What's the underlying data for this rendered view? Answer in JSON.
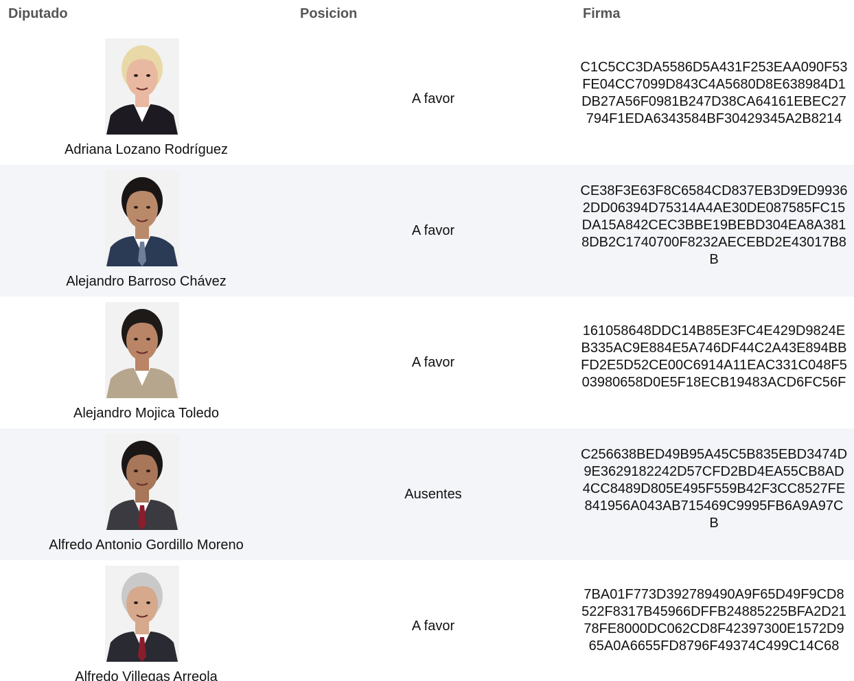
{
  "headers": {
    "diputado": "Diputado",
    "posicion": "Posicion",
    "firma": "Firma"
  },
  "rows": [
    {
      "name": "Adriana Lozano Rodríguez",
      "position": "A favor",
      "firma": "C1C5CC3DA5586D5A431F253EAA090F53FE04CC7099D843C4A5680D8E638984D1DB27A56F0981B247D38CA64161EBEC27794F1EDA6343584BF30429345A2B8214",
      "photo": {
        "bg": "#f2f2f2",
        "skin": "#e8b9a0",
        "hair": "#e9d9a6",
        "suit": "#1d1a22",
        "tie": "none"
      }
    },
    {
      "name": "Alejandro Barroso Chávez",
      "position": "A favor",
      "firma": "CE38F3E63F8C6584CD837EB3D9ED99362DD06394D75314A4AE30DE087585FC15DA15A842CEC3BBE19BEBD304EA8A3818DB2C1740700F8232AECEBD2E43017B8B",
      "photo": {
        "bg": "#f2f2f2",
        "skin": "#b98a6a",
        "hair": "#1a1616",
        "suit": "#2b3a55",
        "tie": "#6e7f98"
      }
    },
    {
      "name": "Alejandro Mojica Toledo",
      "position": "A favor",
      "firma": "161058648DDC14B85E3FC4E429D9824EB335AC9E884E5A746DF44C2A43E894BBFD2E5D52CE00C6914A11EAC331C048F503980658D0E5F18ECB19483ACD6FC56F",
      "photo": {
        "bg": "#f2f2f2",
        "skin": "#b98566",
        "hair": "#1e1a18",
        "suit": "#b7a68e",
        "tie": "none"
      }
    },
    {
      "name": "Alfredo Antonio Gordillo Moreno",
      "position": "Ausentes",
      "firma": "C256638BED49B95A45C5B835EBD3474D9E3629182242D57CFD2BD4EA55CB8AD4CC8489D805E495F559B42F3CC8527FE841956A043AB715469C9995FB6A9A97CB",
      "photo": {
        "bg": "#f2f2f2",
        "skin": "#a87658",
        "hair": "#1a1716",
        "suit": "#3a3a40",
        "tie": "#8a1d2c"
      }
    },
    {
      "name": "Alfredo Villegas Arreola",
      "position": "A favor",
      "firma": "7BA01F773D392789490A9F65D49F9CD8522F8317B45966DFFB24885225BFA2D2178FE8000DC062CD8F42397300E1572D965A0A6655FD8796F49374C499C14C68",
      "photo": {
        "bg": "#f2f2f2",
        "skin": "#d6a98c",
        "hair": "#c9c9c9",
        "suit": "#2a2a32",
        "tie": "#8a1d2c"
      }
    }
  ]
}
